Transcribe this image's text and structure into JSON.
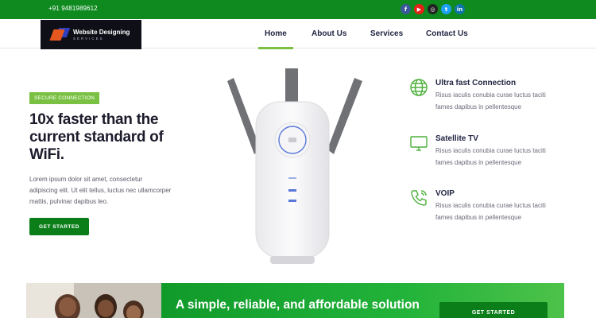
{
  "topbar": {
    "phone": "+91 9481989612",
    "social": [
      {
        "icon": "facebook-icon",
        "glyph": "f",
        "color": "#3b5998"
      },
      {
        "icon": "youtube-icon",
        "glyph": "▶",
        "color": "#e62117"
      },
      {
        "icon": "instagram-icon",
        "glyph": "◎",
        "color": "#222222"
      },
      {
        "icon": "twitter-icon",
        "glyph": "t",
        "color": "#1da1f2"
      },
      {
        "icon": "linkedin-icon",
        "glyph": "in",
        "color": "#0e76a8"
      }
    ]
  },
  "logo": {
    "title": "Website Designing",
    "subtitle": "SERVICES"
  },
  "nav": {
    "items": [
      "Home",
      "About Us",
      "Services",
      "Contact Us"
    ],
    "active": "Home"
  },
  "hero": {
    "badge": "SECURE CONNECTION",
    "headline": "10x faster than the current standard of WiFi.",
    "lede": "Lorem ipsum dolor sit amet, consectetur adipiscing elit. Ut elit tellus, luctus nec ullamcorper mattis, pulvinar dapibus leo.",
    "cta": "GET STARTED"
  },
  "features": [
    {
      "icon": "globe-icon",
      "title": "Ultra fast Connection",
      "desc": "Risus iaculis conubia curae luctus taciti fames dapibus in pellentesque"
    },
    {
      "icon": "tv-icon",
      "title": "Satellite TV",
      "desc": "Risus iaculis conubia curae luctus taciti fames dapibus in pellentesque"
    },
    {
      "icon": "phone-icon",
      "title": "VOIP",
      "desc": "Risus iaculis conubia curae luctus taciti fames dapibus in pellentesque"
    }
  ],
  "banner": {
    "title": "A simple, reliable, and affordable solution",
    "cta": "GET STARTED"
  },
  "colors": {
    "brand_green": "#0e8a1f",
    "accent_lime": "#7ac143",
    "dark_text": "#1b1b2b"
  }
}
